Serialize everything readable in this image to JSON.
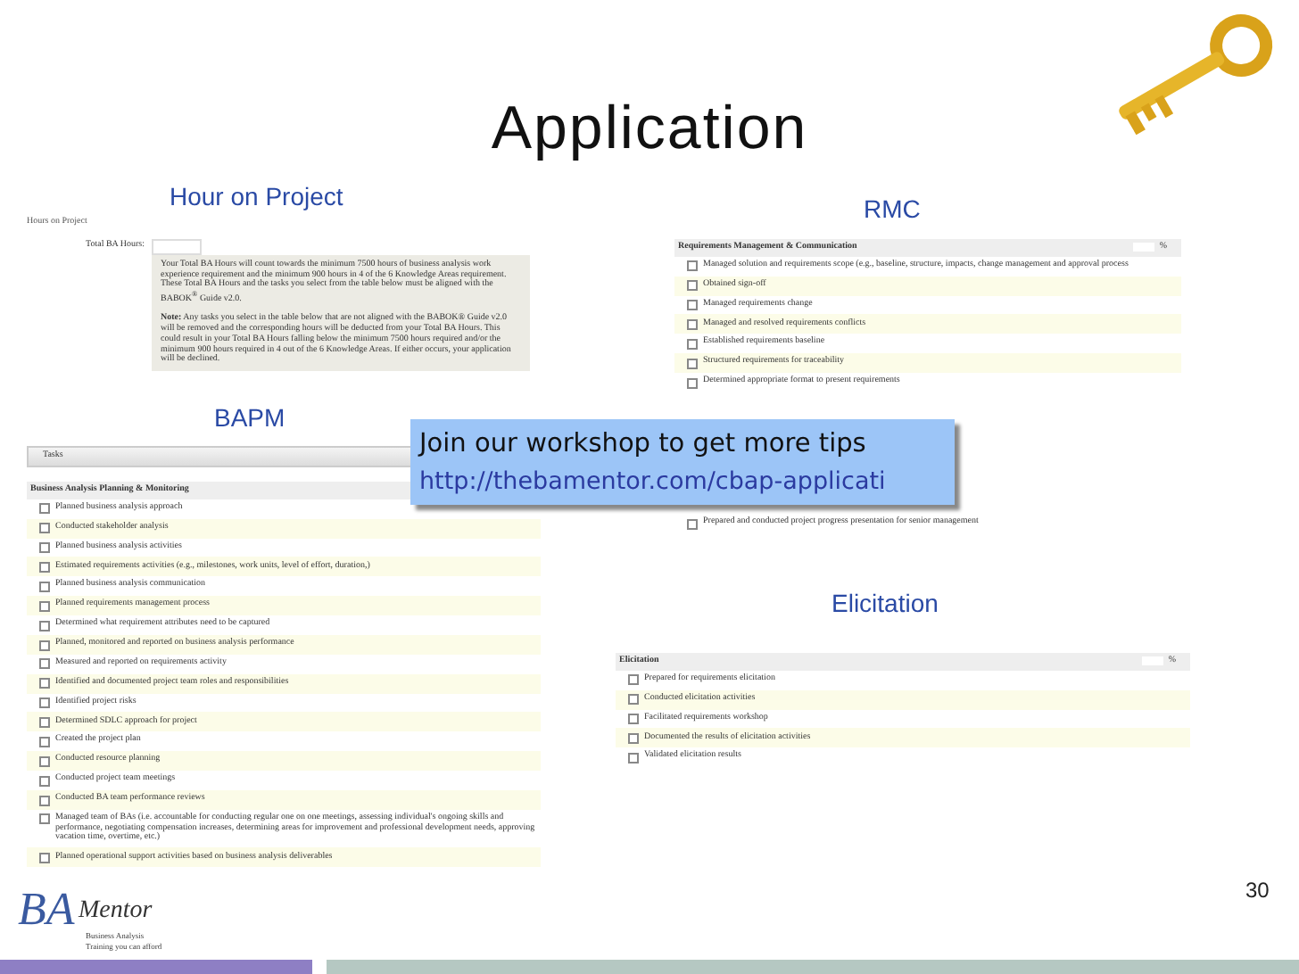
{
  "slide": {
    "title": "Application",
    "page_number": "30"
  },
  "hours_panel": {
    "label": "Hour on Project",
    "heading": "Hours on Project",
    "field_label": "Total BA Hours:",
    "note_paragraphs": [
      "Your Total BA Hours will count towards the minimum 7500 hours of business analysis work experience requirement and the minimum 900 hours in 4 of the 6 Knowledge Areas requirement. These Total BA Hours and the tasks you select from the table below must be aligned with the BABOK$^{®}$ Guide v2.0.",
      "**Note:** Any tasks you select in the table below that are not aligned with the BABOK® Guide v2.0 will be removed and the corresponding hours will be deducted from your Total BA Hours. This could result in your Total BA Hours falling below the minimum 7500 hours required and/or the minimum 900 hours required in 4 out of the 6 Knowledge Areas. If either occurs, your application will be declined."
    ]
  },
  "checklists": [
    {
      "label": "RMC",
      "heading": "Requirements Management & Communication",
      "percent": "%",
      "items": [
        {
          "text": "Managed solution and requirements scope (e.g., baseline, structure, impacts, change management and approval process",
          "checked": false
        },
        {
          "text": "Obtained sign-off",
          "checked": false
        },
        {
          "text": "Managed requirements change",
          "checked": false
        },
        {
          "text": "Managed and resolved requirements conflicts",
          "checked": false
        },
        {
          "text": "Established requirements baseline",
          "checked": false
        },
        {
          "text": "Structured requirements for traceability",
          "checked": false
        },
        {
          "text": "Determined appropriate format to present requirements",
          "checked": false
        }
      ],
      "items_after_gap": [
        {
          "text": "Prepared and conducted project progress presentation for senior management",
          "checked": false
        }
      ]
    },
    {
      "label": "BAPM",
      "tasks_header": "Tasks",
      "heading": "Business Analysis Planning & Monitoring",
      "items": [
        {
          "text": "Planned business analysis approach",
          "checked": false
        },
        {
          "text": "Conducted stakeholder analysis",
          "checked": false
        },
        {
          "text": "Planned business analysis activities",
          "checked": false
        },
        {
          "text": "Estimated requirements activities (e.g., milestones, work units, level of effort, duration,)",
          "checked": false
        },
        {
          "text": "Planned business analysis communication",
          "checked": false
        },
        {
          "text": "Planned requirements management process",
          "checked": false
        },
        {
          "text": "Determined what requirement attributes need to be captured",
          "checked": false
        },
        {
          "text": "Planned, monitored and reported on business analysis performance",
          "checked": false
        },
        {
          "text": "Measured and reported on requirements activity",
          "checked": false
        },
        {
          "text": "Identified and documented project team roles and responsibilities",
          "checked": false
        },
        {
          "text": "Identified project risks",
          "checked": false
        },
        {
          "text": "Determined SDLC approach for project",
          "checked": false
        },
        {
          "text": "Created the project plan",
          "checked": false
        },
        {
          "text": "Conducted resource planning",
          "checked": false
        },
        {
          "text": "Conducted project team meetings",
          "checked": false
        },
        {
          "text": "Conducted BA team performance reviews",
          "checked": false
        },
        {
          "text": "Managed team of BAs (i.e. accountable for conducting regular one on one meetings, assessing individual's ongoing skills and performance, negotiating compensation increases, determining areas for improvement and professional development needs, approving vacation time, overtime, etc.)",
          "checked": false
        },
        {
          "text": "Planned operational support activities based on business analysis deliverables",
          "checked": false
        }
      ]
    },
    {
      "label": "Elicitation",
      "heading": "Elicitation",
      "percent": "%",
      "items": [
        {
          "text": "Prepared for requirements elicitation",
          "checked": false
        },
        {
          "text": "Conducted elicitation activities",
          "checked": false
        },
        {
          "text": "Facilitated requirements workshop",
          "checked": false
        },
        {
          "text": "Documented the results of elicitation activities",
          "checked": false
        },
        {
          "text": "Validated elicitation results",
          "checked": false
        }
      ]
    }
  ],
  "callout": {
    "text": "Join our workshop to get more tips",
    "link": "http://thebamentor.com/cbap-applicati"
  },
  "logo": {
    "mark": "BA",
    "name": "Mentor",
    "tagline_1": "Business Analysis",
    "tagline_2": "Training you can afford"
  }
}
